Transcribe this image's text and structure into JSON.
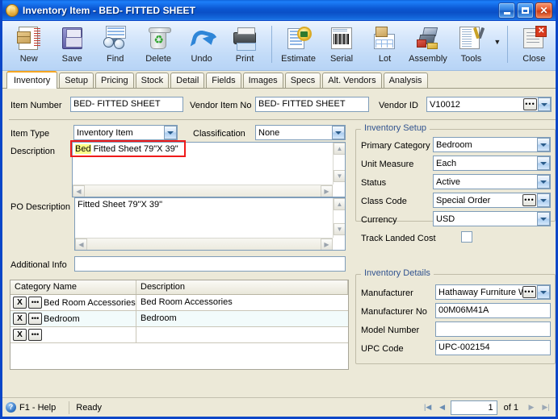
{
  "window": {
    "title": "Inventory Item - BED- FITTED SHEET",
    "icon": "inventory-item-icon",
    "minimize_label": "_",
    "maximize_label": "□",
    "close_label": "✕"
  },
  "toolbar": {
    "buttons": [
      {
        "label": "New",
        "icon": "new-document-icon"
      },
      {
        "label": "Save",
        "icon": "floppy-disk-icon"
      },
      {
        "label": "Find",
        "icon": "binoculars-icon"
      },
      {
        "label": "Delete",
        "icon": "recycle-bin-icon"
      },
      {
        "label": "Undo",
        "icon": "undo-arrow-icon"
      },
      {
        "label": "Print",
        "icon": "printer-icon"
      },
      {
        "label": "Estimate",
        "icon": "estimate-seal-icon"
      },
      {
        "label": "Serial",
        "icon": "barcode-icon"
      },
      {
        "label": "Lot",
        "icon": "lot-grid-icon"
      },
      {
        "label": "Assembly",
        "icon": "assembly-parts-icon"
      },
      {
        "label": "Tools",
        "icon": "tools-wrench-icon"
      },
      {
        "label": "Close",
        "icon": "close-window-icon"
      }
    ],
    "tools_dropdown": "▼"
  },
  "tabs": [
    {
      "label": "Inventory",
      "active": true
    },
    {
      "label": "Setup",
      "active": false
    },
    {
      "label": "Pricing",
      "active": false
    },
    {
      "label": "Stock",
      "active": false
    },
    {
      "label": "Detail",
      "active": false
    },
    {
      "label": "Fields",
      "active": false
    },
    {
      "label": "Images",
      "active": false
    },
    {
      "label": "Specs",
      "active": false
    },
    {
      "label": "Alt. Vendors",
      "active": false
    },
    {
      "label": "Analysis",
      "active": false
    }
  ],
  "form": {
    "item_number": {
      "label": "Item Number",
      "value": "BED- FITTED SHEET"
    },
    "vendor_item_no": {
      "label": "Vendor Item No",
      "value": "BED- FITTED SHEET"
    },
    "vendor_id": {
      "label": "Vendor ID",
      "value": "V10012",
      "ellipsis": "•••"
    },
    "item_type": {
      "label": "Item Type",
      "value": "Inventory Item"
    },
    "classification": {
      "label": "Classification",
      "value": "None"
    },
    "description": {
      "label": "Description",
      "highlighted_word": "Bed",
      "rest": " Fitted Sheet 79\"X 39\""
    },
    "po_description": {
      "label": "PO Description",
      "value": "Fitted Sheet 79\"X 39\""
    },
    "additional_info": {
      "label": "Additional Info",
      "value": ""
    }
  },
  "inventory_setup": {
    "title": "Inventory Setup",
    "fields": [
      {
        "label": "Primary Category",
        "value": "Bedroom",
        "has_ellipsis": false
      },
      {
        "label": "Unit Measure",
        "value": "Each",
        "has_ellipsis": false
      },
      {
        "label": "Status",
        "value": "Active",
        "has_ellipsis": false
      },
      {
        "label": "Class Code",
        "value": "Special Order",
        "has_ellipsis": true
      },
      {
        "label": "Currency",
        "value": "USD",
        "has_ellipsis": false
      }
    ],
    "track_landed_cost": {
      "label": "Track Landed Cost",
      "checked": false
    }
  },
  "inventory_details": {
    "title": "Inventory Details",
    "manufacturer": {
      "label": "Manufacturer",
      "value": "Hathaway Furniture W",
      "has_ellipsis": true
    },
    "manufacturer_no": {
      "label": "Manufacturer No",
      "value": "00M06M41A"
    },
    "model_number": {
      "label": "Model Number",
      "value": ""
    },
    "upc_code": {
      "label": "UPC Code",
      "value": "UPC-002154"
    }
  },
  "category_grid": {
    "columns": [
      "Category Name",
      "Description"
    ],
    "rows": [
      {
        "name": "Bed Room Accessories",
        "description": "Bed Room Accessories"
      },
      {
        "name": "Bedroom",
        "description": "Bedroom"
      },
      {
        "name": "",
        "description": ""
      }
    ],
    "delete_button": "X",
    "lookup_button": "•••"
  },
  "statusbar": {
    "help_icon": "question-mark-icon",
    "help_label": "F1 - Help",
    "status": "Ready",
    "first_label": "|◀",
    "prev_label": "◀",
    "page_value": "1",
    "of_label": "of  1",
    "next_label": "▶",
    "last_label": "▶|"
  },
  "colors": {
    "titlebar_blue": "#0a50c8",
    "accent_orange": "#f5a623",
    "group_title": "#31538f",
    "highlight_yellow": "#ffff88",
    "annotation_red": "#ef1a1a",
    "face": "#ece9d8"
  }
}
